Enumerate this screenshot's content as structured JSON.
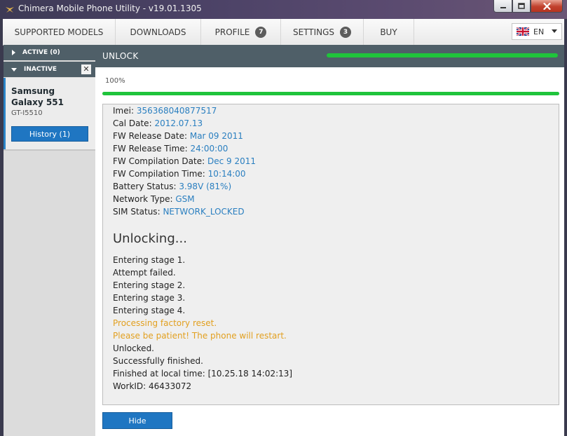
{
  "window": {
    "title": "Chimera Mobile Phone Utility - v19.01.1305",
    "icon": "chimera-logo-icon",
    "controls": [
      "minimize-icon",
      "maximize-icon",
      "close-icon"
    ]
  },
  "menu": {
    "items": [
      {
        "label": "SUPPORTED MODELS"
      },
      {
        "label": "DOWNLOADS"
      },
      {
        "label": "PROFILE",
        "badge": "7"
      },
      {
        "label": "SETTINGS",
        "badge": "3"
      },
      {
        "label": "BUY"
      }
    ],
    "language": {
      "value": "EN",
      "icon": "uk-flag-icon"
    }
  },
  "sidebar": {
    "active_label": "ACTIVE (0)",
    "inactive_label": "INACTIVE",
    "device": {
      "name": "Samsung Galaxy 551",
      "model": "GT-I5510",
      "history_button": "History (1)"
    }
  },
  "main": {
    "header_title": "UNLOCK",
    "progress_percent_text": "100%",
    "progress_fraction": 1.0,
    "info": [
      {
        "label": "Imei:",
        "value": "356368040877517"
      },
      {
        "label": "Cal Date:",
        "value": "2012.07.13"
      },
      {
        "label": "FW Release Date:",
        "value": "Mar 09 2011"
      },
      {
        "label": "FW Release Time:",
        "value": "24:00:00"
      },
      {
        "label": "FW Compilation Date:",
        "value": "Dec 9 2011"
      },
      {
        "label": "FW Compilation Time:",
        "value": "10:14:00"
      },
      {
        "label": "Battery Status:",
        "value": "3.98V (81%)"
      },
      {
        "label": "Network Type:",
        "value": "GSM"
      },
      {
        "label": "SIM Status:",
        "value": "NETWORK_LOCKED"
      }
    ],
    "unlocking_heading": "Unlocking...",
    "log": [
      {
        "text": "Entering stage 1.",
        "warn": false
      },
      {
        "text": "Attempt failed.",
        "warn": false
      },
      {
        "text": "Entering stage 2.",
        "warn": false
      },
      {
        "text": "Entering stage 3.",
        "warn": false
      },
      {
        "text": "Entering stage 4.",
        "warn": false
      },
      {
        "text": "Processing factory reset.",
        "warn": true
      },
      {
        "text": "Please be patient! The phone will restart.",
        "warn": true
      },
      {
        "text": "Unlocked.",
        "warn": false
      },
      {
        "text": "Successfully finished.",
        "warn": false
      },
      {
        "text": "Finished at local time: [10.25.18 14:02:13]",
        "warn": false
      },
      {
        "text": "WorkID: 46433072",
        "warn": false
      }
    ],
    "hide_button": "Hide"
  },
  "colors": {
    "accent": "#1f76c2",
    "progress": "#1fc43b",
    "header": "#4f5f68",
    "value_text": "#2a7fc0",
    "warning": "#e2a020"
  }
}
